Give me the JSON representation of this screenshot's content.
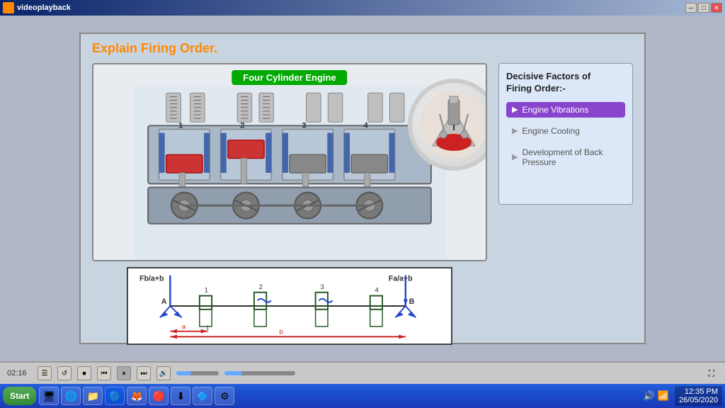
{
  "window": {
    "title": "videoplayback",
    "icon": "🎬"
  },
  "titlebar": {
    "minimize": "─",
    "maximize": "□",
    "close": "✕"
  },
  "slide": {
    "title_prefix": "Explain ",
    "title_highlight": "Firing Order.",
    "engine_label": "Four Cylinder Engine"
  },
  "factors": {
    "title": "Decisive Factors of",
    "title2": "Firing Order:-",
    "items": [
      {
        "label": "Engine Vibrations",
        "active": true
      },
      {
        "label": "Engine Cooling",
        "active": false
      },
      {
        "label": "Development of Back Pressure",
        "active": false
      }
    ]
  },
  "forces": {
    "left_label": "Fb/a+b",
    "right_label": "Fa/a+b",
    "point_a": "A",
    "point_b": "B",
    "label_a": "a",
    "label_b": "b",
    "numbers": [
      "1",
      "2",
      "3",
      "4"
    ]
  },
  "controls": {
    "time": "02:16",
    "play": "⏸",
    "rewind": "⏮",
    "forward": "⏭",
    "restart": "↺",
    "stop": "⏹",
    "volume": "🔊",
    "fullscreen": "⛶"
  },
  "taskbar": {
    "start": "Start",
    "apps": [
      "🖥",
      "🌐",
      "📁",
      "🔵",
      "🦊",
      "🔴",
      "⬇",
      "🔷",
      "⚙"
    ],
    "clock_time": "12:35 PM",
    "clock_date": "26/05/2020",
    "volume_icon": "🔊",
    "network_icon": "📶"
  }
}
